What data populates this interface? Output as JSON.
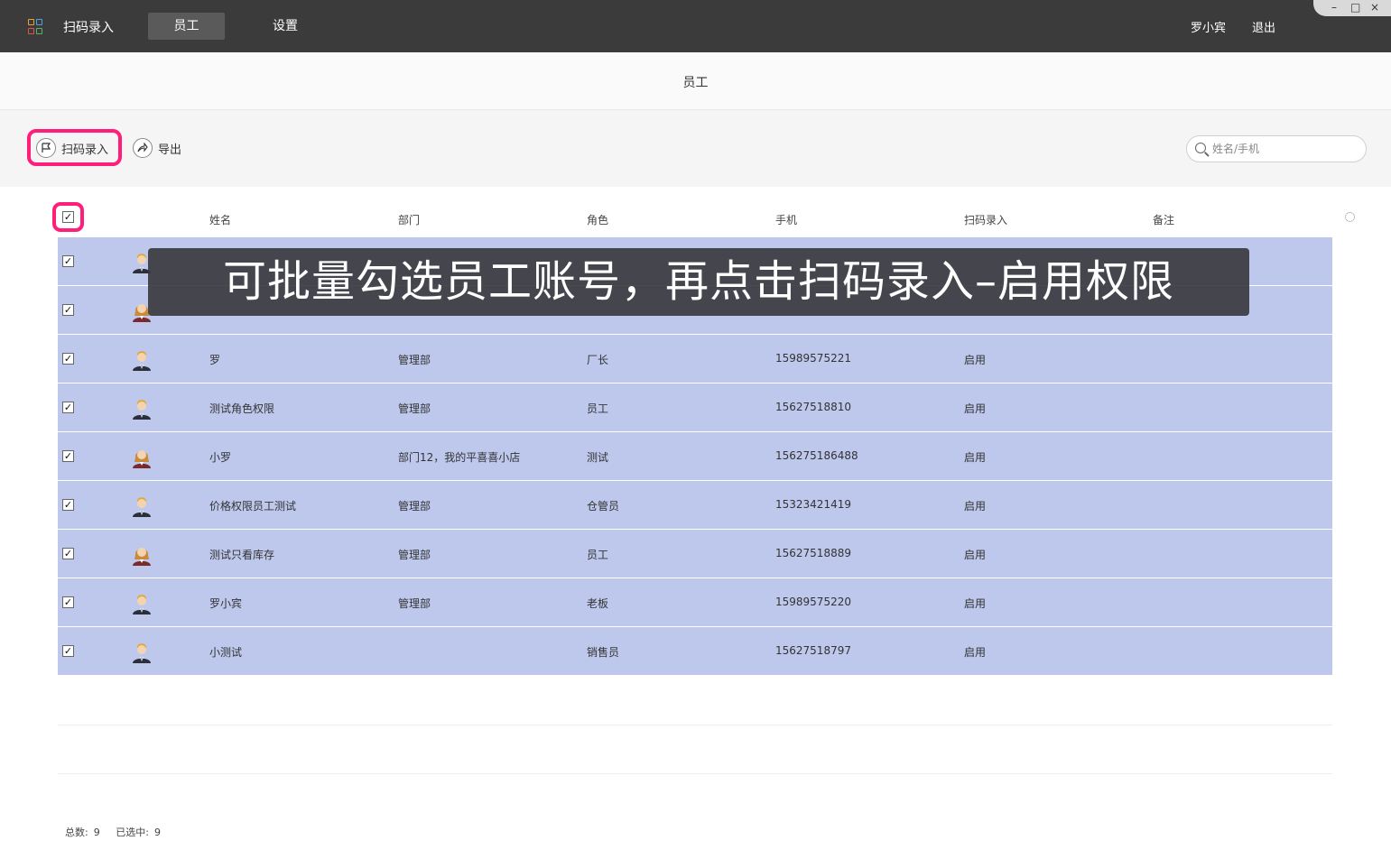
{
  "topbar": {
    "app_title": "扫码录入",
    "tabs": [
      {
        "label": "员工",
        "active": true
      },
      {
        "label": "设置",
        "active": false
      }
    ],
    "user_name": "罗小宾",
    "logout": "退出",
    "window_controls": [
      "–",
      "□",
      "×"
    ]
  },
  "colors": {
    "topbar": "#3b3b3b",
    "highlight": "#ff1f7a",
    "selected_row": "#bdc8ec",
    "logo": [
      "#e8a23b",
      "#4aa3df",
      "#e0534a",
      "#58b368"
    ]
  },
  "header": {
    "title": "员工"
  },
  "toolbar": {
    "scan_label": "扫码录入",
    "scan_icon": "flag-icon",
    "export_label": "导出",
    "export_icon": "share-icon",
    "search_placeholder": "姓名/手机"
  },
  "table": {
    "columns": [
      "姓名",
      "部门",
      "角色",
      "手机",
      "扫码录入",
      "备注"
    ],
    "rows": [
      {
        "checked": true,
        "avatar": "male",
        "name": "",
        "dept": "",
        "role": "",
        "phone": "",
        "scan": "",
        "note": ""
      },
      {
        "checked": true,
        "avatar": "female",
        "name": "",
        "dept": "",
        "role": "",
        "phone": "",
        "scan": "",
        "note": ""
      },
      {
        "checked": true,
        "avatar": "male",
        "name": "罗",
        "dept": "管理部",
        "role": "厂长",
        "phone": "15989575221",
        "scan": "启用",
        "note": ""
      },
      {
        "checked": true,
        "avatar": "male",
        "name": "测试角色权限",
        "dept": "管理部",
        "role": "员工",
        "phone": "15627518810",
        "scan": "启用",
        "note": ""
      },
      {
        "checked": true,
        "avatar": "female",
        "name": "小罗",
        "dept": "部门12，我的平喜喜小店",
        "role": "测试",
        "phone": "156275186488",
        "scan": "启用",
        "note": ""
      },
      {
        "checked": true,
        "avatar": "male",
        "name": "价格权限员工测试",
        "dept": "管理部",
        "role": "仓管员",
        "phone": "15323421419",
        "scan": "启用",
        "note": ""
      },
      {
        "checked": true,
        "avatar": "female",
        "name": "测试只看库存",
        "dept": "管理部",
        "role": "员工",
        "phone": "15627518889",
        "scan": "启用",
        "note": ""
      },
      {
        "checked": true,
        "avatar": "male",
        "name": "罗小宾",
        "dept": "管理部",
        "role": "老板",
        "phone": "15989575220",
        "scan": "启用",
        "note": ""
      },
      {
        "checked": true,
        "avatar": "male",
        "name": "小测试",
        "dept": "",
        "role": "销售员",
        "phone": "15627518797",
        "scan": "启用",
        "note": ""
      }
    ]
  },
  "footer": {
    "total_label": "总数:",
    "total": "9",
    "selected_label": "已选中:",
    "selected": "9"
  },
  "caption": "可批量勾选员工账号，再点击扫码录入–启用权限"
}
